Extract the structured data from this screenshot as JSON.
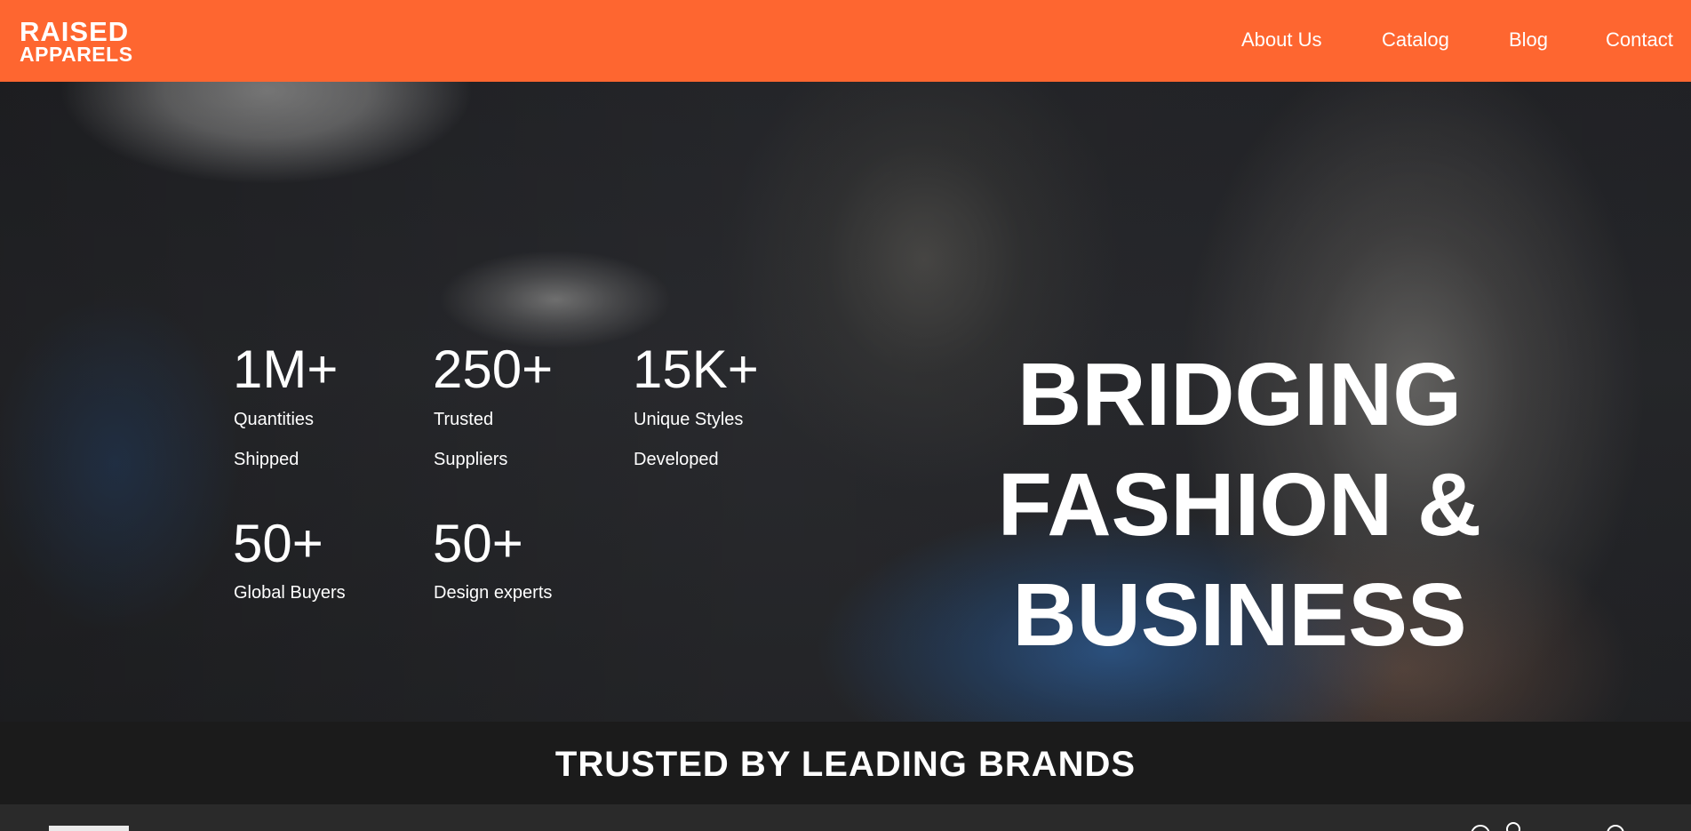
{
  "brand": {
    "line1": "RAISED",
    "line2": "APPARELS",
    "color": "#fe6630"
  },
  "nav": {
    "items": [
      {
        "label": "About Us"
      },
      {
        "label": "Catalog"
      },
      {
        "label": "Blog"
      },
      {
        "label": "Contact"
      }
    ]
  },
  "hero": {
    "stats": [
      {
        "value": "1M+",
        "label": "Quantities Shipped"
      },
      {
        "value": "250+",
        "label": "Trusted Suppliers"
      },
      {
        "value": "15K+",
        "label": "Unique Styles Developed"
      },
      {
        "value": "50+",
        "label": "Global Buyers"
      },
      {
        "value": "50+",
        "label": "Design experts"
      }
    ],
    "headline": {
      "line1": "BRIDGING",
      "line2": "FASHION &",
      "line3": "BUSINESS"
    }
  },
  "trusted": {
    "title": "TRUSTED BY LEADING BRANDS"
  }
}
